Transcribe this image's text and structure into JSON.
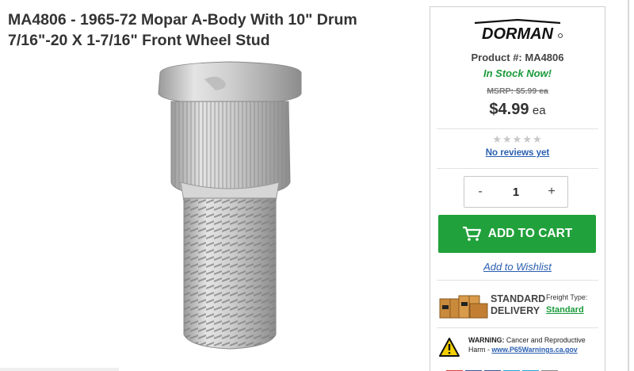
{
  "product": {
    "title_line1": "MA4806 - 1965-72 Mopar A-Body With 10\" Drum",
    "title_line2": "7/16\"-20 X 1-7/16\" Front Wheel Stud"
  },
  "brand": {
    "logo_text": "DORMAN"
  },
  "purchase": {
    "product_number": "Product #: MA4806",
    "stock_status": "In Stock Now!",
    "msrp": "MSRP: $5.99 ea",
    "price": "$4.99",
    "price_unit": "ea",
    "rating_stars": "★★★★★",
    "reviews_link": "No reviews yet",
    "quantity": "1",
    "qty_minus": "-",
    "qty_plus": "+",
    "add_to_cart": "ADD TO CART",
    "add_to_wishlist": "Add to Wishlist"
  },
  "delivery": {
    "label_line1": "STANDARD",
    "label_line2": "DELIVERY",
    "freight_type_label": "Freight Type:",
    "freight_type_value": "Standard"
  },
  "warning": {
    "label": "WARNING:",
    "text": "Cancer and Reproductive",
    "text2": "Harm - ",
    "link": "www.P65Warnings.ca.gov"
  },
  "colors": {
    "accent_green": "#21a13b",
    "stock_green": "#1a9a3a",
    "link_blue": "#2a5fb0"
  }
}
